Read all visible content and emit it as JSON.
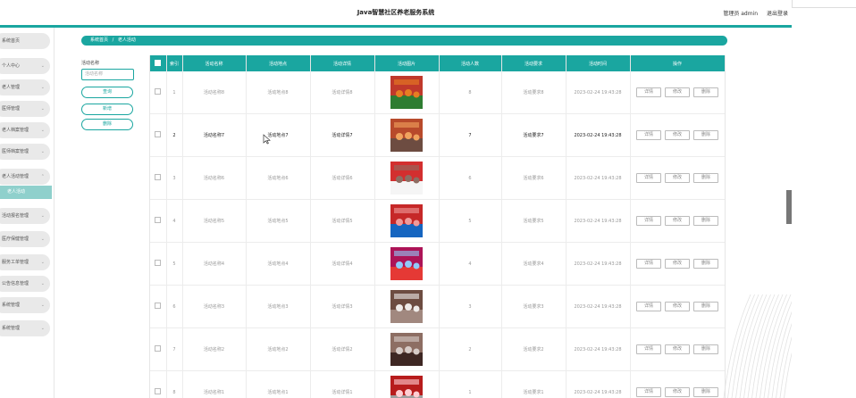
{
  "header": {
    "title": "Java智慧社区养老服务系统",
    "user": "管理员 admin",
    "logout": "退出登录"
  },
  "sidebar": {
    "items": [
      {
        "label": "系统首页",
        "chevron": ""
      },
      {
        "label": "个人中心",
        "chevron": "⌄"
      },
      {
        "label": "老人管理",
        "chevron": "⌄"
      },
      {
        "label": "医师管理",
        "chevron": "⌄"
      },
      {
        "label": "老人档案管理",
        "chevron": "⌄"
      },
      {
        "label": "医师档案管理",
        "chevron": "⌄"
      },
      {
        "label": "老人活动管理",
        "chevron": "⌃"
      },
      {
        "label": "活动报名管理",
        "chevron": "⌄"
      },
      {
        "label": "医疗保健管理",
        "chevron": "⌄"
      },
      {
        "label": "服务工单管理",
        "chevron": "⌄"
      },
      {
        "label": "公告信息管理",
        "chevron": "⌄"
      },
      {
        "label": "系统管理",
        "chevron": "⌄"
      },
      {
        "label": "系统管理",
        "chevron": "⌄"
      }
    ],
    "active_sub": "老人活动"
  },
  "breadcrumb": {
    "home": "系统首页",
    "separator": "/",
    "current": "老人活动"
  },
  "search": {
    "label": "活动名称",
    "placeholder": "活动名称",
    "query_button": "查询",
    "add_button": "新增",
    "delete_button": "删除"
  },
  "table": {
    "columns": [
      "",
      "索引",
      "活动名称",
      "活动地点",
      "活动详情",
      "活动图片",
      "活动人数",
      "活动要求",
      "活动时间",
      "操作"
    ],
    "action_labels": {
      "detail": "详情",
      "edit": "修改",
      "delete": "删除"
    },
    "rows": [
      {
        "index": "1",
        "name": "活动名称8",
        "place": "活动地点8",
        "detail": "活动详情8",
        "count": "8",
        "requirement": "活动要求8",
        "time": "2023-02-24 19:43:28",
        "highlight": false
      },
      {
        "index": "2",
        "name": "活动名称7",
        "place": "活动地点7",
        "detail": "活动详情7",
        "count": "7",
        "requirement": "活动要求7",
        "time": "2023-02-24 19:43:28",
        "highlight": true
      },
      {
        "index": "3",
        "name": "活动名称6",
        "place": "活动地点6",
        "detail": "活动详情6",
        "count": "6",
        "requirement": "活动要求6",
        "time": "2023-02-24 19:43:28",
        "highlight": false
      },
      {
        "index": "4",
        "name": "活动名称5",
        "place": "活动地点5",
        "detail": "活动详情5",
        "count": "5",
        "requirement": "活动要求5",
        "time": "2023-02-24 19:43:28",
        "highlight": false
      },
      {
        "index": "5",
        "name": "活动名称4",
        "place": "活动地点4",
        "detail": "活动详情4",
        "count": "4",
        "requirement": "活动要求4",
        "time": "2023-02-24 19:43:28",
        "highlight": false
      },
      {
        "index": "6",
        "name": "活动名称3",
        "place": "活动地点3",
        "detail": "活动详情3",
        "count": "3",
        "requirement": "活动要求3",
        "time": "2023-02-24 19:43:28",
        "highlight": false
      },
      {
        "index": "7",
        "name": "活动名称2",
        "place": "活动地点2",
        "detail": "活动详情2",
        "count": "2",
        "requirement": "活动要求2",
        "time": "2023-02-24 19:43:28",
        "highlight": false
      },
      {
        "index": "8",
        "name": "活动名称1",
        "place": "活动地点1",
        "detail": "活动详情1",
        "count": "1",
        "requirement": "活动要求1",
        "time": "2023-02-24 19:43:28",
        "highlight": false
      }
    ]
  },
  "colors": {
    "accent": "#1aa6a0",
    "sub_active": "#8fd0cc",
    "menu_bg": "#e9e9e9"
  }
}
